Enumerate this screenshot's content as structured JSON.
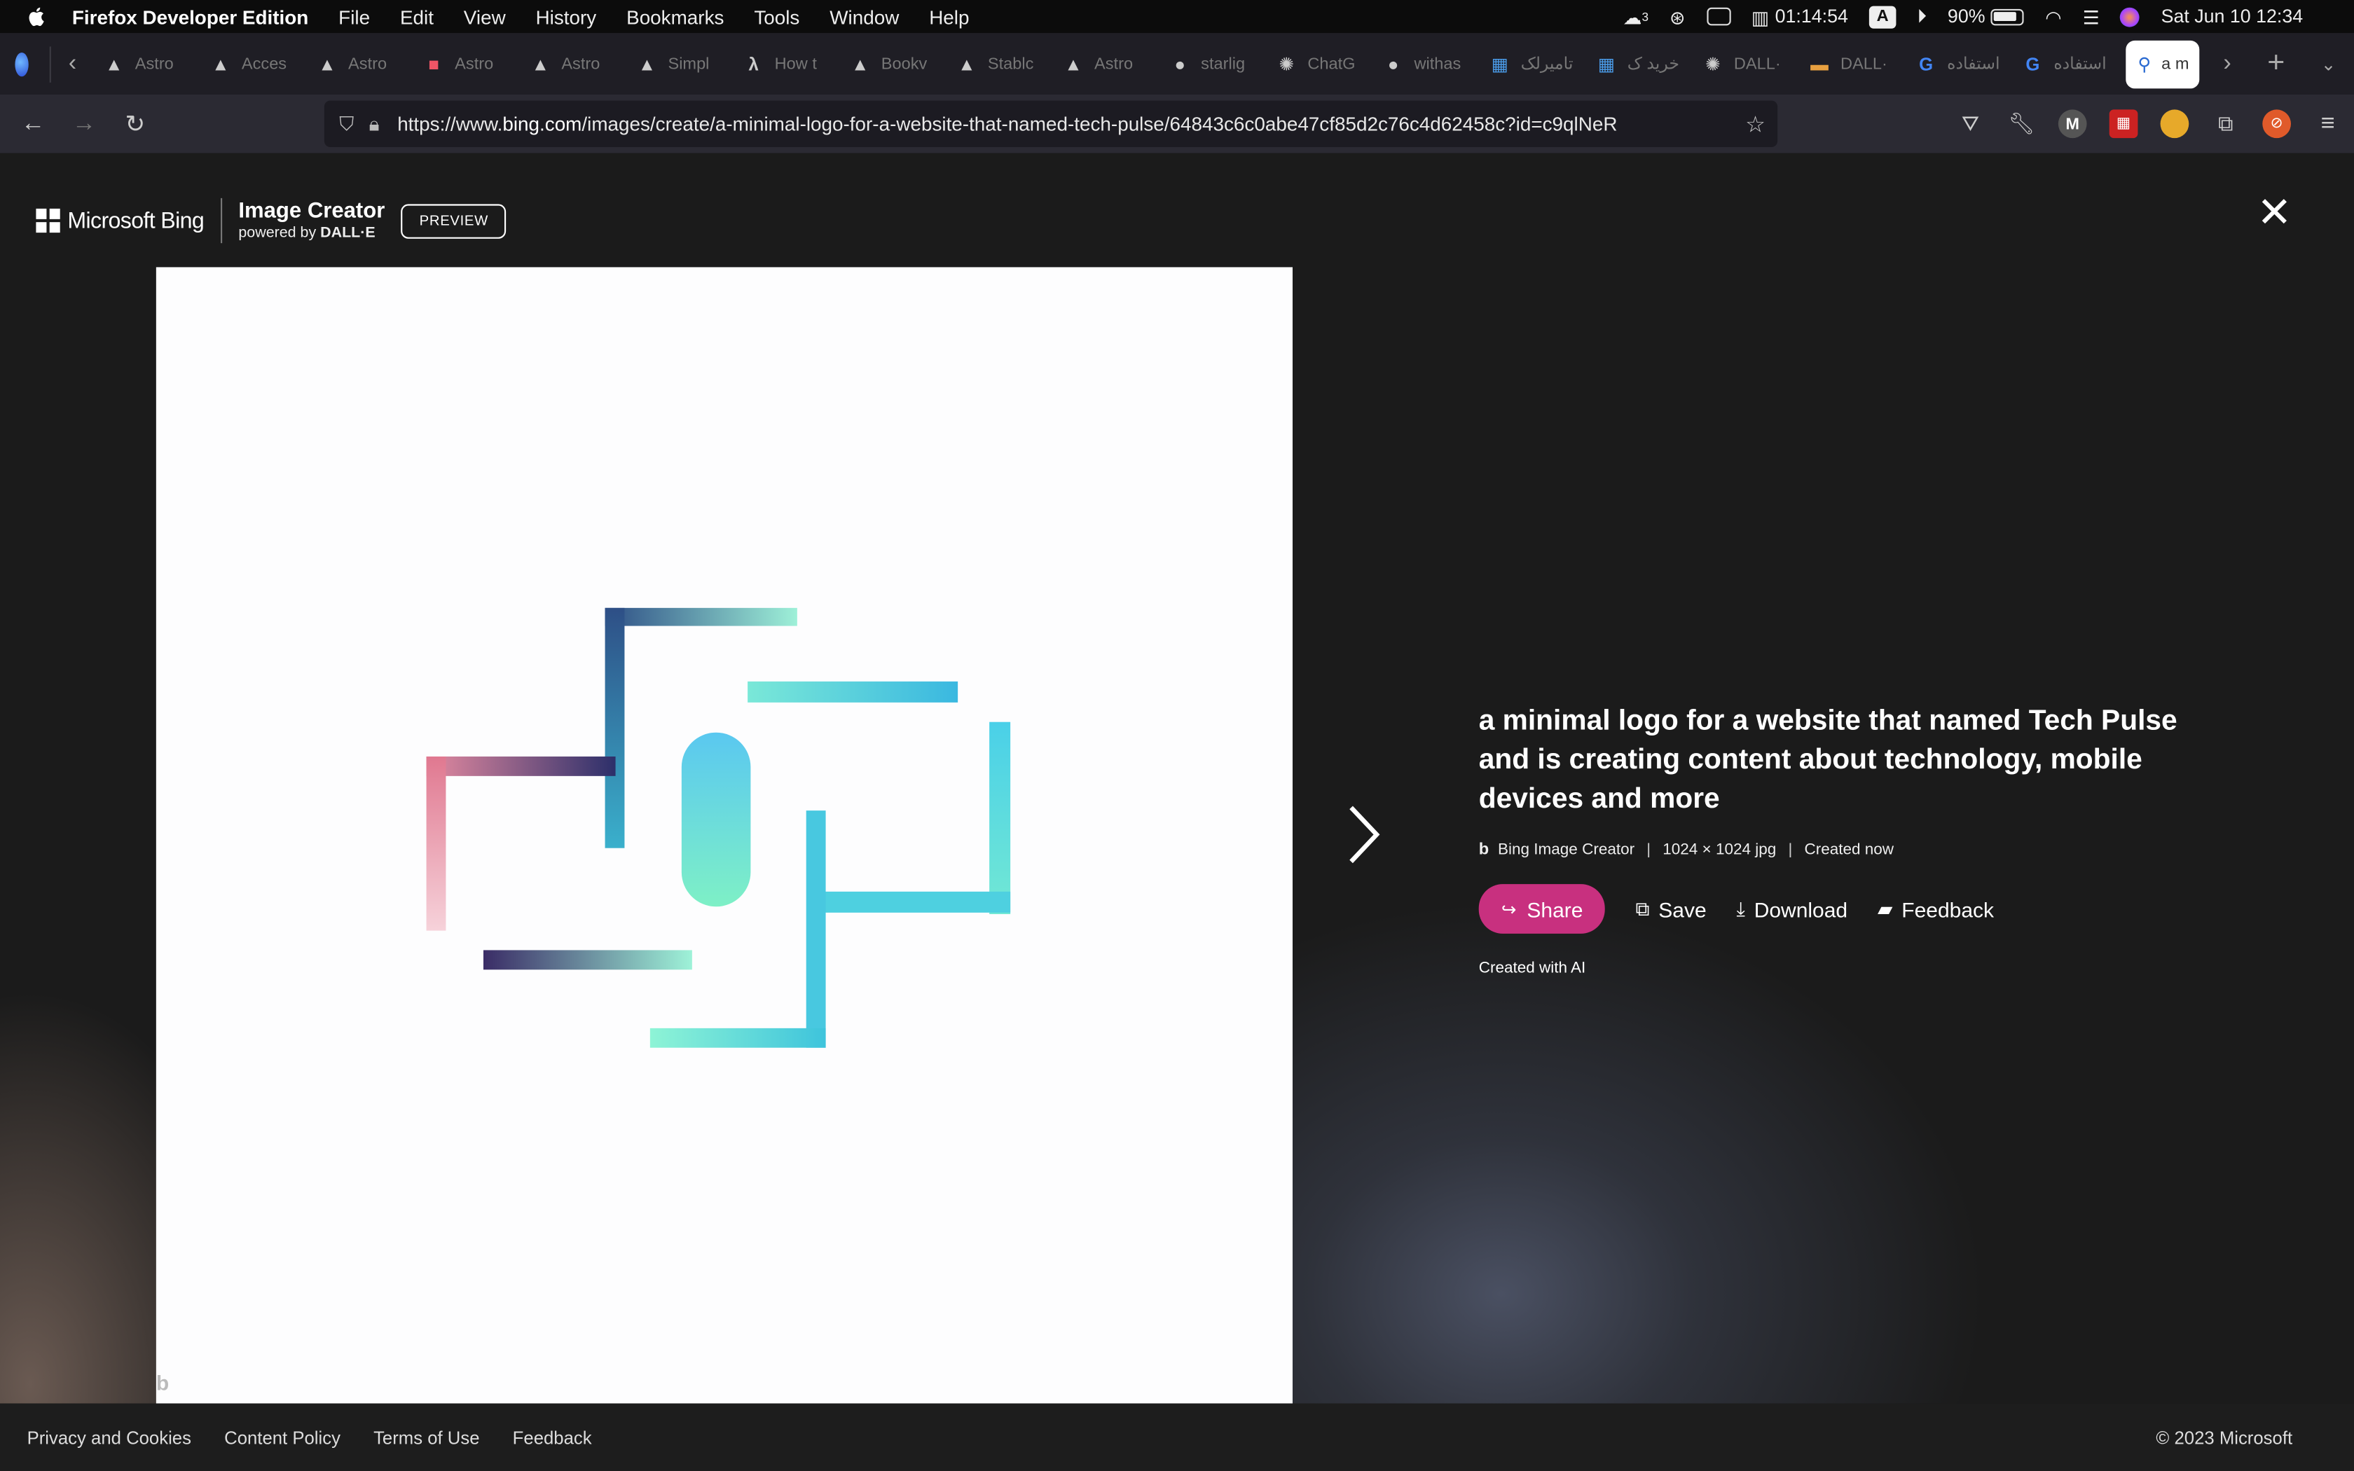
{
  "menubar": {
    "app": "Firefox Developer Edition",
    "items": [
      "File",
      "Edit",
      "View",
      "History",
      "Bookmarks",
      "Tools",
      "Window",
      "Help"
    ],
    "timer": "01:14:54",
    "keyboard": "A",
    "battery": "90%",
    "datetime": "Sat Jun 10  12:34",
    "notification_count": "3"
  },
  "tabs": [
    {
      "label": "Astro",
      "icon": "astro-icon"
    },
    {
      "label": "Acces",
      "icon": "astro-icon"
    },
    {
      "label": "Astro",
      "icon": "astro-icon"
    },
    {
      "label": "Astro",
      "icon": "pink-square-icon"
    },
    {
      "label": "Astro",
      "icon": "astro-icon"
    },
    {
      "label": "Simpl",
      "icon": "astro-icon"
    },
    {
      "label": "How t",
      "icon": "lambda-icon"
    },
    {
      "label": "Bookv",
      "icon": "astro-icon"
    },
    {
      "label": "Stablc",
      "icon": "astro-icon"
    },
    {
      "label": "Astro",
      "icon": "astro-icon"
    },
    {
      "label": "starlig",
      "icon": "github-icon"
    },
    {
      "label": "ChatG",
      "icon": "chatgpt-icon"
    },
    {
      "label": "withas",
      "icon": "github-icon"
    },
    {
      "label": "تامیرلک",
      "icon": "grid-icon"
    },
    {
      "label": "خرید ک",
      "icon": "grid-icon"
    },
    {
      "label": "DALL·",
      "icon": "openai-icon"
    },
    {
      "label": "DALL·",
      "icon": "dalle-icon"
    },
    {
      "label": "استفاده",
      "icon": "google-icon"
    },
    {
      "label": "استفاده",
      "icon": "google-icon"
    }
  ],
  "active_tab": {
    "label": "a m",
    "icon": "search-icon"
  },
  "url": {
    "prefix": "https://www.",
    "host": "bing.com",
    "path": "/images/create/a-minimal-logo-for-a-website-that-named-tech-pulse/64843c6c0abe47cf85d2c76c4d62458c?id=c9qlNeR"
  },
  "header": {
    "brand": "Microsoft Bing",
    "product": "Image Creator",
    "powered_prefix": "powered by ",
    "powered_by": "DALL·E",
    "preview": "PREVIEW"
  },
  "image": {
    "watermark": "b"
  },
  "details": {
    "prompt": "a minimal logo for a website that named Tech Pulse and is creating content about technology, mobile devices and more",
    "source": "Bing Image Creator",
    "dimensions": "1024 × 1024 jpg",
    "created": "Created now",
    "share": "Share",
    "save": "Save",
    "download": "Download",
    "feedback": "Feedback",
    "created_with_ai": "Created with AI"
  },
  "footer": {
    "links": [
      "Privacy and Cookies",
      "Content Policy",
      "Terms of Use",
      "Feedback"
    ],
    "copyright": "© 2023 Microsoft"
  },
  "colors": {
    "share_button": "#c8307f",
    "page_bg": "#1b1b1b"
  }
}
